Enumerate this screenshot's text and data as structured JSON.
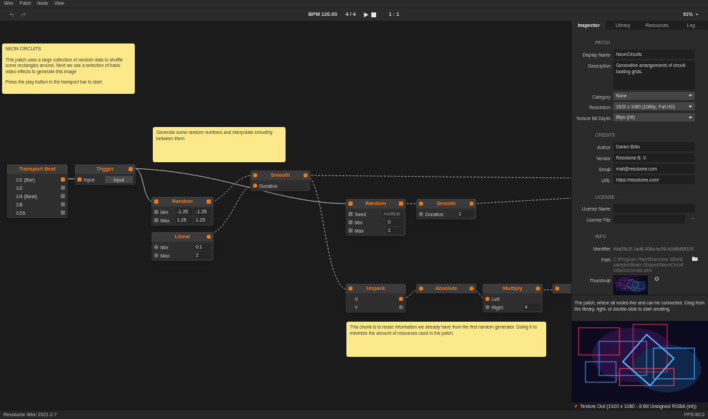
{
  "menu": [
    "Wire",
    "Patch",
    "Node",
    "View"
  ],
  "transport": {
    "bpm": "BPM 120.00",
    "signature": "4 / 4",
    "position": "1 : 1"
  },
  "zoom": "91%",
  "notes": [
    {
      "paragraphs": [
        "NEON CIRCUITS",
        "This patch uses a large collection of random data to shuffle some rectangles around. Next we use a selection of basic video effects to generate this image",
        "Press the play button in the transport bar to start."
      ]
    },
    {
      "paragraphs": [
        "Generate some random numbers and interpolate smoothly between them"
      ]
    },
    {
      "paragraphs": [
        "This chunk is to reuse information we already have from the first random generator. Doing it to minimize the amount of resources used in the patch."
      ]
    }
  ],
  "nodes": [
    {
      "title": "Transport Beat",
      "rows": [
        {
          "label": "1/1 (Bar)",
          "out_port": {
            "kind": "square",
            "connected": true
          }
        },
        {
          "label": "1/2",
          "out_port": {
            "kind": "square",
            "connected": false
          }
        },
        {
          "label": "1/4 (Beat)",
          "out_port": {
            "kind": "square",
            "connected": false
          }
        },
        {
          "label": "1/8",
          "out_port": {
            "kind": "square",
            "connected": false
          }
        },
        {
          "label": "1/16",
          "out_port": {
            "kind": "square",
            "connected": false
          }
        }
      ]
    },
    {
      "title": "Trigger",
      "output_port": {
        "kind": "square",
        "connected": true
      },
      "rows": [
        {
          "label": "Input",
          "in_port": {
            "kind": "square",
            "connected": true
          },
          "button": "Input"
        }
      ]
    },
    {
      "title": "Random",
      "input_port": {
        "kind": "square",
        "connected": true
      },
      "output_port": {
        "kind": "square",
        "connected": true
      },
      "rows": [
        {
          "label": "Min",
          "in_port": {
            "kind": "square",
            "connected": false
          },
          "values": [
            "-1.25",
            "-1.25"
          ]
        },
        {
          "label": "Max",
          "in_port": {
            "kind": "square",
            "connected": false
          },
          "values": [
            "1.25",
            "1.25"
          ]
        }
      ]
    },
    {
      "title": "Linear",
      "output_port": {
        "kind": "circle",
        "connected": true
      },
      "rows": [
        {
          "label": "Min",
          "in_port": {
            "kind": "circle",
            "connected": false
          },
          "values": [
            "0.1"
          ]
        },
        {
          "label": "Max",
          "in_port": {
            "kind": "circle",
            "connected": false
          },
          "values": [
            "2"
          ]
        }
      ]
    },
    {
      "title": "Smooth",
      "input_port": {
        "kind": "circle",
        "connected": true
      },
      "output_port": {
        "kind": "circle",
        "connected": true
      },
      "rows": [
        {
          "label": "Duration",
          "in_port": {
            "kind": "circle",
            "connected": true
          }
        }
      ]
    },
    {
      "title": "Random",
      "input_port": {
        "kind": "square",
        "connected": true
      },
      "output_port": {
        "kind": "square",
        "connected": true
      },
      "rows": [
        {
          "label": "Seed",
          "in_port": {
            "kind": "square",
            "connected": false
          },
          "placeholder": "multiple"
        },
        {
          "label": "Min",
          "in_port": {
            "kind": "square",
            "connected": false
          },
          "values": [
            "0"
          ]
        },
        {
          "label": "Max",
          "in_port": {
            "kind": "square",
            "connected": false
          },
          "values": [
            "1"
          ]
        }
      ]
    },
    {
      "title": "Smooth",
      "input_port": {
        "kind": "circle",
        "connected": true
      },
      "output_port": {
        "kind": "circle",
        "connected": true
      },
      "rows": [
        {
          "label": "Duration",
          "in_port": {
            "kind": "circle",
            "connected": false
          },
          "values": [
            "1"
          ]
        }
      ]
    },
    {
      "title": "Unpack",
      "input_port": {
        "kind": "circle",
        "connected": true
      },
      "rows": [
        {
          "label": "X",
          "out_port": {
            "kind": "circle",
            "connected": true
          }
        },
        {
          "label": "Y",
          "out_port": {
            "kind": "circle",
            "connected": false
          }
        }
      ]
    },
    {
      "title": "Absolute",
      "input_port": {
        "kind": "circle",
        "connected": true
      },
      "output_port": {
        "kind": "circle",
        "connected": true
      }
    },
    {
      "title": "Multiply",
      "output_port": {
        "kind": "circle",
        "connected": true
      },
      "rows": [
        {
          "label": "Left",
          "in_port": {
            "kind": "circle",
            "connected": true
          }
        },
        {
          "label": "Right",
          "in_port": {
            "kind": "circle",
            "connected": false
          },
          "values": [
            "4"
          ]
        }
      ]
    },
    {
      "input_port": {
        "kind": "circle",
        "connected": true
      }
    }
  ],
  "inspector": {
    "tabs": [
      {
        "label": "Inspector",
        "selected": true
      },
      {
        "label": "Library",
        "selected": false
      },
      {
        "label": "Resources",
        "selected": false
      },
      {
        "label": "Log",
        "selected": false
      }
    ],
    "sections": [
      {
        "title": "PATCH",
        "fields": [
          {
            "label": "Display Name",
            "kind": "text",
            "value": "NeonCircuits"
          },
          {
            "label": "Description",
            "kind": "textarea",
            "value": "Generative arrangements of circuit-looking grids."
          },
          {
            "label": "Category",
            "kind": "select",
            "value": "None"
          },
          {
            "label": "Resolution",
            "kind": "select",
            "value": "1920 x 1080 (1080p, Full HD)"
          },
          {
            "label": "Texture Bit Depth",
            "kind": "select",
            "value": "8bpc (int)"
          }
        ]
      },
      {
        "title": "CREDITS",
        "fields": [
          {
            "label": "Author",
            "kind": "text",
            "value": "Darien Brito"
          },
          {
            "label": "Vendor",
            "kind": "text",
            "value": "Resolume B. V."
          },
          {
            "label": "Email",
            "kind": "text",
            "value": "mail@resolume.com"
          },
          {
            "label": "URL",
            "kind": "text",
            "value": "https://resolume.com/"
          }
        ]
      },
      {
        "title": "LICENSE",
        "fields": [
          {
            "label": "License Name",
            "kind": "text"
          },
          {
            "label": "License File",
            "kind": "file",
            "button": "..."
          }
        ]
      },
      {
        "title": "INFO",
        "fields": [
          {
            "label": "Identifier",
            "kind": "info",
            "value": "4da06c2f-1ad6-408a-bc96-b1b8bf6ff100"
          },
          {
            "label": "Path",
            "kind": "path",
            "value": "C:\\Program Files\\Resolume Wire\\Examples\\Basic Shapes\\NeonCircuits\\NeonCircuits.wire"
          },
          {
            "label": "Thumbnail",
            "kind": "thumbnail"
          }
        ]
      }
    ]
  },
  "help": "The patch, where all nodes live and can be connected. Drag from the library, right- or double-click to start creating.",
  "preview": {
    "caption": "Texture Out (1920 x 1080 - 8 Bit Unsigned RGBA (int))"
  },
  "status": {
    "version": "Resolume Wire 2021.2.7",
    "fps": "FPS 60.0"
  }
}
